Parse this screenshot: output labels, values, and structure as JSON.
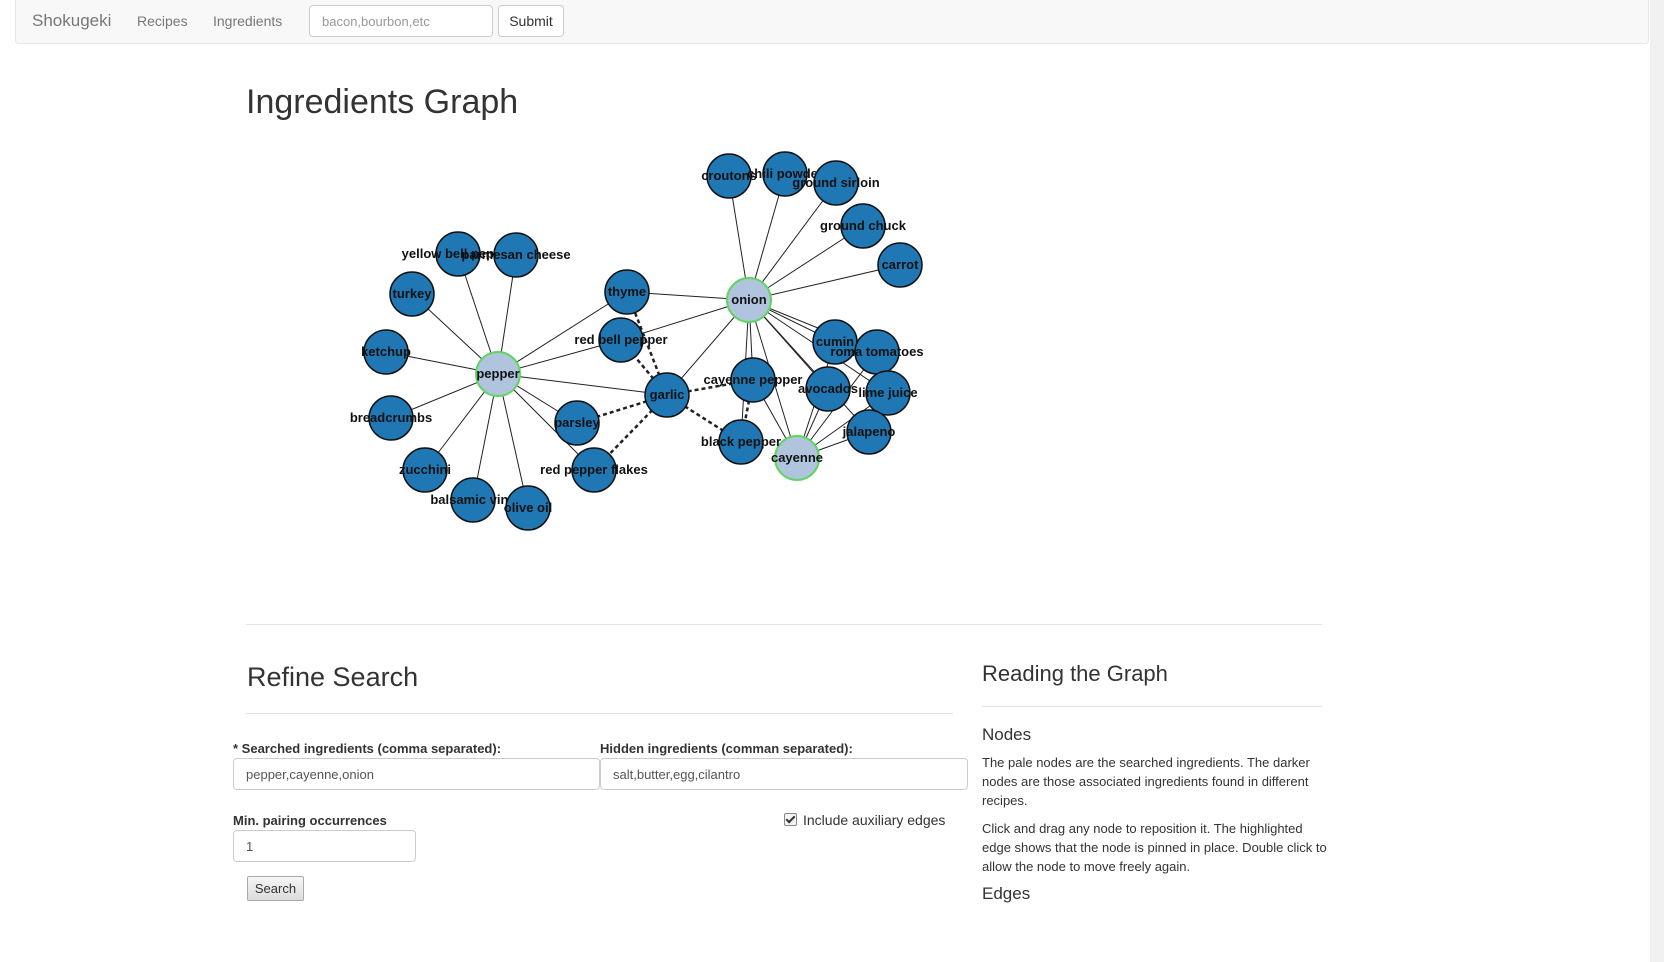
{
  "navbar": {
    "brand": "Shokugeki",
    "links": [
      "Recipes",
      "Ingredients"
    ],
    "search_placeholder": "bacon,bourbon,etc",
    "submit_label": "Submit"
  },
  "page_title": "Ingredients Graph",
  "graph": {
    "searched_color": "#b0c4de",
    "associated_color": "#1f77b4",
    "nodes": [
      {
        "id": "pepper",
        "label": "pepper",
        "searched": true
      },
      {
        "id": "onion",
        "label": "onion",
        "searched": true
      },
      {
        "id": "cayenne",
        "label": "cayenne",
        "searched": true
      },
      {
        "id": "garlic",
        "label": "garlic",
        "searched": false
      },
      {
        "id": "thyme",
        "label": "thyme",
        "searched": false
      },
      {
        "id": "red bell pepper",
        "label": "red bell pepper",
        "searched": false
      },
      {
        "id": "parsley",
        "label": "parsley",
        "searched": false
      },
      {
        "id": "red pepper flakes",
        "label": "red pepper flakes",
        "searched": false
      },
      {
        "id": "yellow bell pepper",
        "label": "yellow bell pepper",
        "searched": false
      },
      {
        "id": "parmesan cheese",
        "label": "parmesan cheese",
        "searched": false
      },
      {
        "id": "turkey",
        "label": "turkey",
        "searched": false
      },
      {
        "id": "ketchup",
        "label": "ketchup",
        "searched": false
      },
      {
        "id": "breadcrumbs",
        "label": "breadcrumbs",
        "searched": false
      },
      {
        "id": "zucchini",
        "label": "zucchini",
        "searched": false
      },
      {
        "id": "balsamic vinegar",
        "label": "balsamic vine",
        "searched": false
      },
      {
        "id": "olive oil",
        "label": "olive oil",
        "searched": false
      },
      {
        "id": "croutons",
        "label": "croutons",
        "searched": false
      },
      {
        "id": "chili powder",
        "label": "chili powder",
        "searched": false
      },
      {
        "id": "ground sirloin",
        "label": "ground sirloin",
        "searched": false
      },
      {
        "id": "ground chuck",
        "label": "ground chuck",
        "searched": false
      },
      {
        "id": "carrot",
        "label": "carrot",
        "searched": false
      },
      {
        "id": "cumin",
        "label": "cumin",
        "searched": false
      },
      {
        "id": "roma tomatoes",
        "label": "roma tomatoes",
        "searched": false
      },
      {
        "id": "lime juice",
        "label": "lime juice",
        "searched": false
      },
      {
        "id": "avocados",
        "label": "avocados",
        "searched": false
      },
      {
        "id": "jalapeno",
        "label": "jalapeno",
        "searched": false
      },
      {
        "id": "cayenne pepper",
        "label": "cayenne pepper",
        "searched": false
      },
      {
        "id": "black pepper",
        "label": "black pepper",
        "searched": false
      }
    ],
    "edges": [
      {
        "source": "pepper",
        "target": "yellow bell pepper",
        "dashed": false
      },
      {
        "source": "pepper",
        "target": "parmesan cheese",
        "dashed": false
      },
      {
        "source": "pepper",
        "target": "turkey",
        "dashed": false
      },
      {
        "source": "pepper",
        "target": "ketchup",
        "dashed": false
      },
      {
        "source": "pepper",
        "target": "breadcrumbs",
        "dashed": false
      },
      {
        "source": "pepper",
        "target": "zucchini",
        "dashed": false
      },
      {
        "source": "pepper",
        "target": "balsamic vinegar",
        "dashed": false
      },
      {
        "source": "pepper",
        "target": "olive oil",
        "dashed": false
      },
      {
        "source": "pepper",
        "target": "parsley",
        "dashed": false
      },
      {
        "source": "pepper",
        "target": "red pepper flakes",
        "dashed": false
      },
      {
        "source": "pepper",
        "target": "garlic",
        "dashed": false
      },
      {
        "source": "pepper",
        "target": "red bell pepper",
        "dashed": false
      },
      {
        "source": "pepper",
        "target": "thyme",
        "dashed": false
      },
      {
        "source": "onion",
        "target": "croutons",
        "dashed": false
      },
      {
        "source": "onion",
        "target": "chili powder",
        "dashed": false
      },
      {
        "source": "onion",
        "target": "ground sirloin",
        "dashed": false
      },
      {
        "source": "onion",
        "target": "ground chuck",
        "dashed": false
      },
      {
        "source": "onion",
        "target": "carrot",
        "dashed": false
      },
      {
        "source": "onion",
        "target": "thyme",
        "dashed": false
      },
      {
        "source": "onion",
        "target": "red bell pepper",
        "dashed": false
      },
      {
        "source": "onion",
        "target": "garlic",
        "dashed": false
      },
      {
        "source": "onion",
        "target": "cumin",
        "dashed": false
      },
      {
        "source": "onion",
        "target": "roma tomatoes",
        "dashed": false
      },
      {
        "source": "onion",
        "target": "lime juice",
        "dashed": false
      },
      {
        "source": "onion",
        "target": "avocados",
        "dashed": false
      },
      {
        "source": "onion",
        "target": "jalapeno",
        "dashed": false
      },
      {
        "source": "onion",
        "target": "cayenne pepper",
        "dashed": false
      },
      {
        "source": "onion",
        "target": "black pepper",
        "dashed": false
      },
      {
        "source": "onion",
        "target": "cayenne",
        "dashed": false
      },
      {
        "source": "cayenne",
        "target": "cumin",
        "dashed": false
      },
      {
        "source": "cayenne",
        "target": "roma tomatoes",
        "dashed": false
      },
      {
        "source": "cayenne",
        "target": "lime juice",
        "dashed": false
      },
      {
        "source": "cayenne",
        "target": "avocados",
        "dashed": false
      },
      {
        "source": "cayenne",
        "target": "jalapeno",
        "dashed": false
      },
      {
        "source": "cayenne",
        "target": "cayenne pepper",
        "dashed": false
      },
      {
        "source": "garlic",
        "target": "thyme",
        "dashed": true
      },
      {
        "source": "garlic",
        "target": "red bell pepper",
        "dashed": true
      },
      {
        "source": "garlic",
        "target": "parsley",
        "dashed": true
      },
      {
        "source": "garlic",
        "target": "red pepper flakes",
        "dashed": true
      },
      {
        "source": "garlic",
        "target": "cayenne pepper",
        "dashed": true
      },
      {
        "source": "garlic",
        "target": "black pepper",
        "dashed": true
      },
      {
        "source": "cayenne pepper",
        "target": "black pepper",
        "dashed": true
      }
    ]
  },
  "refine": {
    "title": "Refine Search",
    "searched_label": "* Searched ingredients (comma separated):",
    "searched_value": "pepper,cayenne,onion",
    "hidden_label": "Hidden ingredients (comman separated):",
    "hidden_value": "salt,butter,egg,cilantro",
    "min_label": "Min. pairing occurrences",
    "min_value": "1",
    "aux_label": "Include auxiliary edges",
    "aux_checked": true,
    "search_button": "Search"
  },
  "help": {
    "title": "Reading the Graph",
    "nodes_heading": "Nodes",
    "nodes_p1": "The pale nodes are the searched ingredients. The darker nodes are those associated ingredients found in different recipes.",
    "nodes_p2": "Click and drag any node to reposition it. The highlighted edge shows that the node is pinned in place. Double click to allow the node to move freely again.",
    "edges_heading": "Edges"
  }
}
